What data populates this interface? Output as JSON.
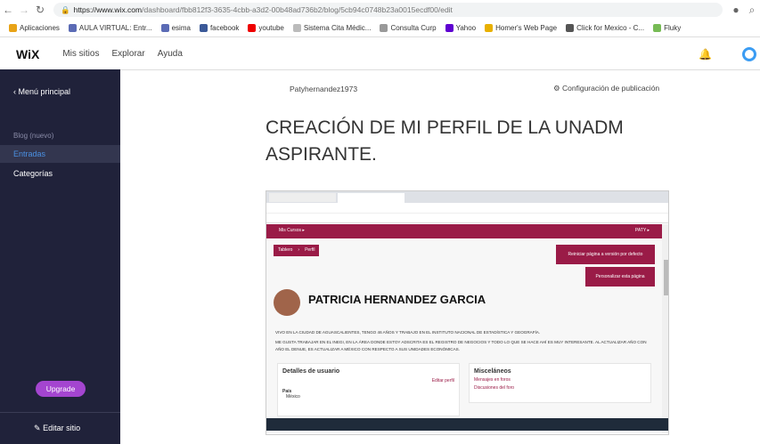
{
  "browser": {
    "url_domain": "https://www.wix.com",
    "url_path": "/dashboard/fbb812f3-3635-4cbb-a3d2-00b48ad736b2/blog/5cb94c0748b23a0015ecdf00/edit",
    "bookmarks": [
      {
        "label": "Aplicaciones",
        "color": "#e8a317"
      },
      {
        "label": "AULA VIRTUAL: Entr...",
        "color": "#5b6bb5"
      },
      {
        "label": "esima",
        "color": "#5b6bb5"
      },
      {
        "label": "facebook",
        "color": "#3b5998"
      },
      {
        "label": "youtube",
        "color": "#e00"
      },
      {
        "label": "Sistema Cita Médic...",
        "color": "#bbb"
      },
      {
        "label": "Consulta Curp",
        "color": "#999"
      },
      {
        "label": "Yahoo",
        "color": "#5f01d1"
      },
      {
        "label": "Homer's Web Page",
        "color": "#e8b000"
      },
      {
        "label": "Click for Mexico - C...",
        "color": "#555"
      },
      {
        "label": "Fluky",
        "color": "#7b5"
      }
    ]
  },
  "wix": {
    "logo": "WiX",
    "menu": [
      "Mis sitios",
      "Explorar",
      "Ayuda"
    ]
  },
  "sidebar": {
    "back": "Menú principal",
    "section": "Blog (nuevo)",
    "items": [
      "Entradas",
      "Categorías"
    ],
    "upgrade": "Upgrade",
    "edit_site": "Editar sitio"
  },
  "post": {
    "author": "Patyhernandez1973",
    "settings": "Configuración de publicación",
    "title": "CREACIÓN DE MI PERFIL DE LA UNADM ASPIRANTE."
  },
  "embedded": {
    "menu": "Mis Cursos ▸",
    "user": "PATY ▸",
    "breadcrumb": [
      "Tablero",
      "Perfil"
    ],
    "reset_button": "Reiniciar página a versión por defecto",
    "customize_button": "Personalizar esta página",
    "name": "PATRICIA HERNANDEZ GARCIA",
    "bio1": "VIVO EN LA CIUDAD DE AGUASCALIENTES, TENGO 46 AÑOS Y TRABAJO EN EL INSTITUTO NACIONAL DE ESTADÍSTICA Y GEOGRAFÍA.",
    "bio2": "ME GUSTA TRABAJAR EN EL INEGI, EN LA ÁREA DONDE ESTOY ADSCRITA ES EL REGISTRO DE NEGOCIOS Y TODO LO QUE SE HACE AHÍ ES MUY INTERESANTE. AL ACTUALIZAR AÑO CON AÑO EL DENUE, ES ACTUALIZAR A MÉXICO CON RESPECTO A SUS UNIDADES ECONÓMICAS.",
    "details_title": "Detalles de usuario",
    "edit_profile": "Editar perfil",
    "country_label": "País",
    "country": "México",
    "misc_title": "Misceláneos",
    "misc_links": [
      "Mensajes en foros",
      "Discusiones del foro"
    ]
  },
  "colors": {
    "sidebar": "#20223a",
    "accent": "#9a1b47",
    "upgrade": "#a445d0"
  }
}
